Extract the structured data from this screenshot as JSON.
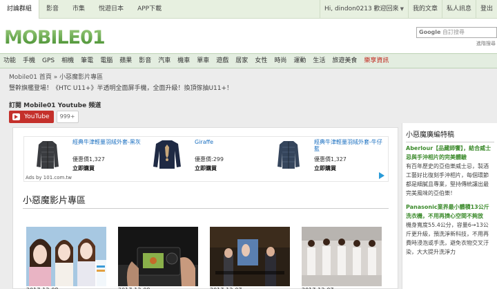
{
  "topbar": {
    "left_items": [
      "討論群組",
      "影音",
      "市集",
      "悅遊日本",
      "APP下載"
    ],
    "user_greeting": "Hi, dindon0213 歡迎回來",
    "right_items": [
      "我的文章",
      "私人訊息",
      "登出"
    ]
  },
  "header": {
    "logo_text": "MOBILE01",
    "search_brand": "Google",
    "search_placeholder": "自訂搜尋",
    "advanced_search": "進階搜尋"
  },
  "catnav": {
    "items": [
      "功能",
      "手機",
      "GPS",
      "相機",
      "筆電",
      "電腦",
      "蘋果",
      "影音",
      "汽車",
      "機車",
      "單車",
      "遊戲",
      "居家",
      "女性",
      "時尚",
      "運動",
      "生活",
      "旅遊美食"
    ],
    "highlight": "樂享資訊"
  },
  "breadcrumb": "Mobile01 首頁 » 小惡魔影片專區",
  "promo": "豎幹旗艦登場！《HTC U11+》半透明全面屏手機，全面升級！換頂傢抽U11+！",
  "youtube": {
    "subscribe_title": "訂閱 Mobile01 Youtube 頻道",
    "button_label": "YouTube",
    "count": "999+"
  },
  "ad": {
    "products": [
      {
        "title": "經典牛津輕量羽絨外套-黑灰",
        "price": "優惠價1,327",
        "buy": "立即購買"
      },
      {
        "title": "Giraffe",
        "price": "優惠價:299",
        "buy": "立即購買"
      },
      {
        "title": "經典牛津輕量羽絨外套-牛仔藍",
        "price": "優惠價1,327",
        "buy": "立即購買"
      }
    ],
    "ads_by": "Ads by 101.com.tw"
  },
  "video_section": {
    "heading": "小惡魔影片專區",
    "captions": [
      "2017-12-08",
      "2017-12-08",
      "2017-12-07",
      "2017-12-07"
    ]
  },
  "sidebar": {
    "heading": "小惡魔廣編特稿",
    "article1_title": "Aberlour【品藏師饗】，結合威士忌與手沖相片的完美體驗",
    "article1_body": "有百年歷史的亞伯樂威士忌，製酒工藝好比復刻手沖相片，每個環節都是細膩且專業，堅持傳統讓出最完美風味的亞伯樂！",
    "article2_title": "Panasonic業界最小體積13公斤洗衣機，不用再擠心空間不夠放",
    "article2_body": "機身寬度55.4公分，容量6→13公斤更升級，預洗淨新科技，不用再費時浸泡或手洗，避免衣物交叉汙染，大大提升洗淨力"
  },
  "colors": {
    "brand_green": "#6aa84f",
    "youtube_red": "#c4302b",
    "link_blue": "#1a6fc0",
    "sidebar_title_green": "#3b8a2b"
  }
}
